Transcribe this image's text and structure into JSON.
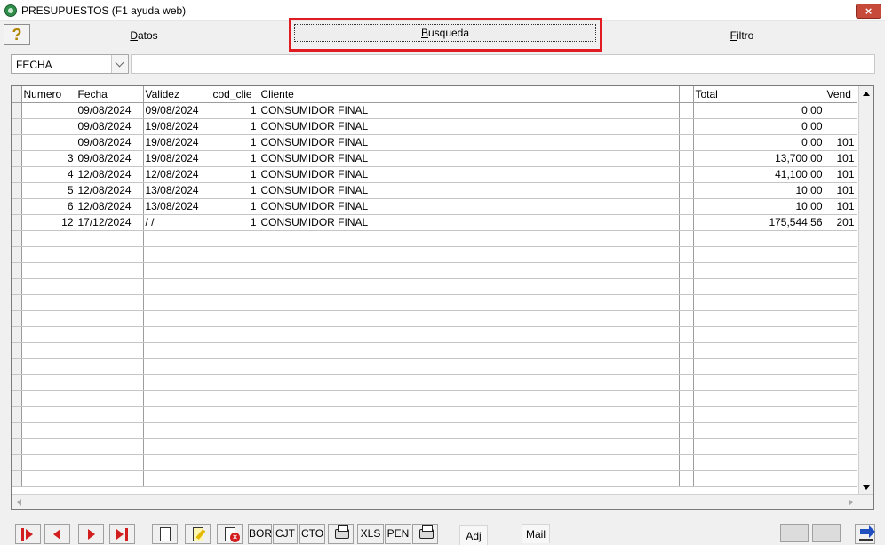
{
  "window": {
    "title": "PRESUPUESTOS (F1 ayuda web)",
    "close_label": "×"
  },
  "help_button": {
    "label": "?"
  },
  "tabs": [
    {
      "prefix": "",
      "underline": "D",
      "rest": "atos"
    },
    {
      "prefix": "",
      "underline": "B",
      "rest": "usqueda"
    },
    {
      "prefix": "",
      "underline": "F",
      "rest": "iltro"
    }
  ],
  "search": {
    "field_value": "FECHA",
    "input_value": ""
  },
  "grid": {
    "columns": [
      "Numero",
      "Fecha",
      "Validez",
      "cod_clie",
      "Cliente",
      "",
      "Total",
      "Vend"
    ],
    "rows": [
      [
        "",
        "09/08/2024",
        "09/08/2024",
        "1",
        "CONSUMIDOR FINAL",
        "",
        "0.00",
        ""
      ],
      [
        "",
        "09/08/2024",
        "19/08/2024",
        "1",
        "CONSUMIDOR FINAL",
        "",
        "0.00",
        ""
      ],
      [
        "",
        "09/08/2024",
        "19/08/2024",
        "1",
        "CONSUMIDOR FINAL",
        "",
        "0.00",
        "101"
      ],
      [
        "3",
        "09/08/2024",
        "19/08/2024",
        "1",
        "CONSUMIDOR FINAL",
        "",
        "13,700.00",
        "101"
      ],
      [
        "4",
        "12/08/2024",
        "12/08/2024",
        "1",
        "CONSUMIDOR FINAL",
        "",
        "41,100.00",
        "101"
      ],
      [
        "5",
        "12/08/2024",
        "13/08/2024",
        "1",
        "CONSUMIDOR FINAL",
        "",
        "10.00",
        "101"
      ],
      [
        "6",
        "12/08/2024",
        "13/08/2024",
        "1",
        "CONSUMIDOR FINAL",
        "",
        "10.00",
        "101"
      ],
      [
        "12",
        "17/12/2024",
        " /  /",
        "1",
        "CONSUMIDOR FINAL",
        "",
        "175,544.56",
        "201"
      ]
    ],
    "empty_rows": 16
  },
  "toolbar": {
    "bor": "BOR",
    "cjt": "CJT",
    "cto": "CTO",
    "xls": "XLS",
    "pen": "PEN",
    "adj": "Adj",
    "mail": "Mail"
  },
  "icons": {
    "first": "first-record-icon",
    "prev": "previous-record-icon",
    "next": "next-record-icon",
    "last": "last-record-icon",
    "new": "new-document-icon",
    "edit": "edit-document-icon",
    "delete": "delete-document-icon",
    "print": "printer-icon",
    "exit": "exit-icon"
  }
}
